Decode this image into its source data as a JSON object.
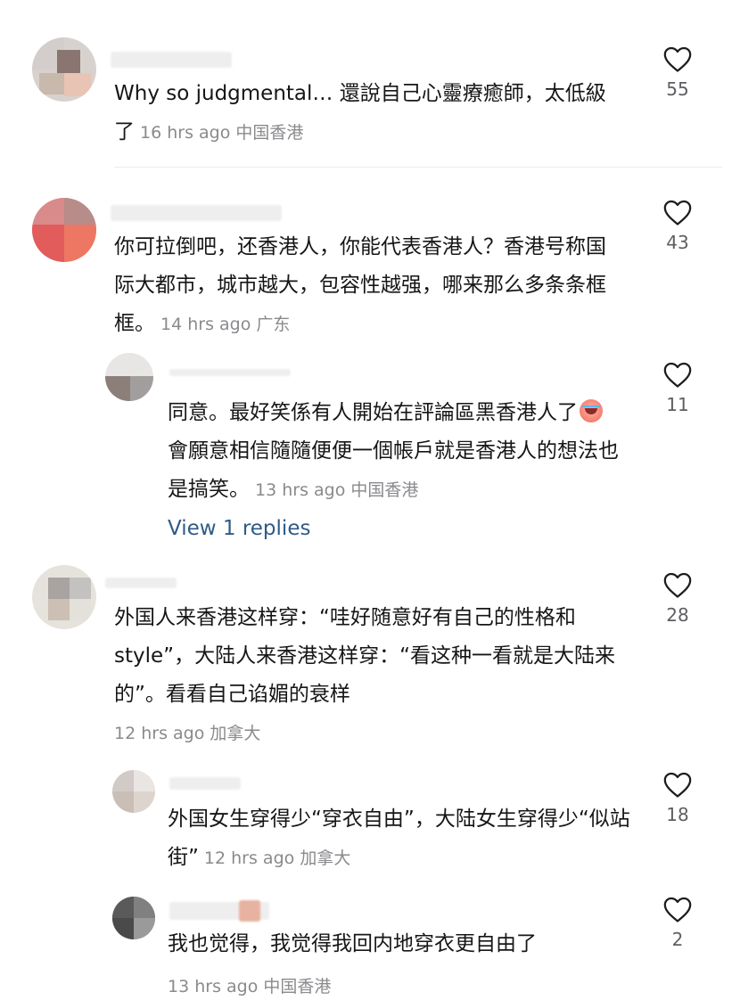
{
  "comments": [
    {
      "text": "Why so judgmental… 還說自己心靈療癒師，太低級了",
      "time": "16 hrs ago",
      "location": "中国香港",
      "likes": "55"
    },
    {
      "text": "你可拉倒吧，还香港人，你能代表香港人？香港号称国际大都市，城市越大，包容性越强，哪来那么多条条框框。",
      "time": "14 hrs ago",
      "location": "广东",
      "likes": "43",
      "replies": [
        {
          "text_before_emoji": "同意。最好笑係有人開始在評論區黑香港人了",
          "emoji": "crying-face-emoji",
          "text_after_emoji": "會願意相信隨隨便便一個帳戶就是香港人的想法也是搞笑。",
          "time": "13 hrs ago",
          "location": "中国香港",
          "likes": "11"
        }
      ],
      "view_replies_label": "View 1 replies"
    },
    {
      "text": "外国人来香港这样穿：“哇好随意好有自己的性格和style”，大陆人来香港这样穿：“看这种一看就是大陆来的”。看看自己谄媚的衰样",
      "time": "12 hrs ago",
      "location": "加拿大",
      "likes": "28",
      "replies": [
        {
          "text": "外国女生穿得少“穿衣自由”，大陆女生穿得少“似站街”",
          "time": "12 hrs ago",
          "location": "加拿大",
          "likes": "18"
        },
        {
          "text": "我也觉得，我觉得我回内地穿衣更自由了",
          "time": "13 hrs ago",
          "location": "中国香港",
          "likes": "2"
        }
      ]
    }
  ],
  "icons": {
    "like": "heart-outline-icon"
  },
  "colors": {
    "link": "#2f5b86",
    "meta": "#8a8a8e",
    "text": "#161616"
  }
}
